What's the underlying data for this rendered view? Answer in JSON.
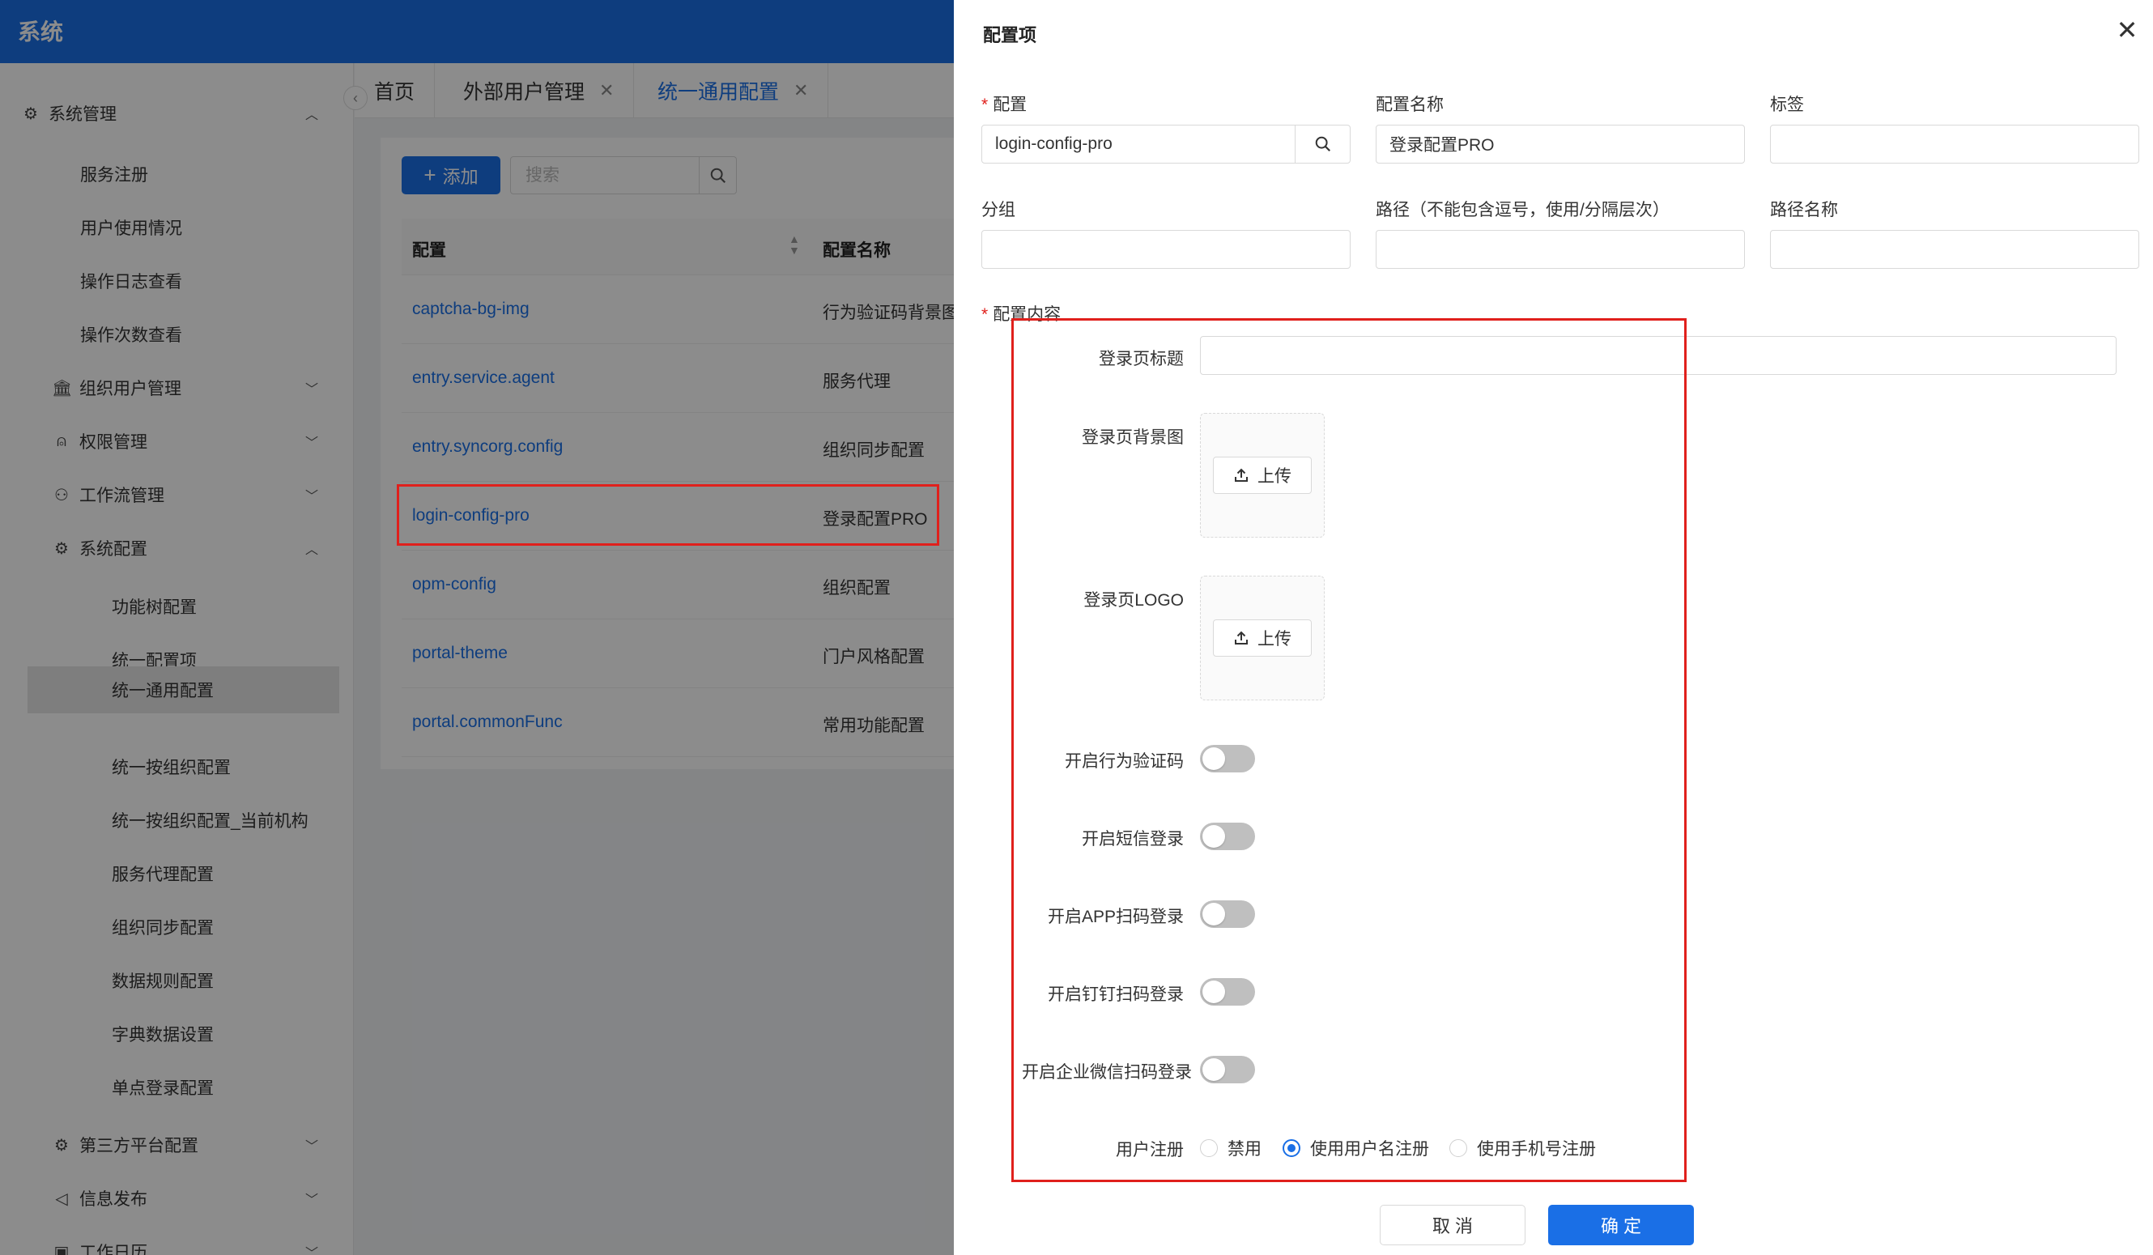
{
  "app": {
    "title": "系统"
  },
  "sidebar": {
    "items": [
      {
        "label": "系统管理",
        "icon": "gear-icon",
        "expanded": true
      },
      {
        "label": "服务注册"
      },
      {
        "label": "用户使用情况"
      },
      {
        "label": "操作日志查看"
      },
      {
        "label": "操作次数查看"
      },
      {
        "label": "组织用户管理",
        "icon": "bank-icon",
        "expanded": false
      },
      {
        "label": "权限管理",
        "icon": "user-icon",
        "expanded": false
      },
      {
        "label": "工作流管理",
        "icon": "workflow-icon",
        "expanded": false
      },
      {
        "label": "系统配置",
        "icon": "gear-icon",
        "expanded": true
      },
      {
        "label": "功能树配置"
      },
      {
        "label": "统一配置项"
      },
      {
        "label": "统一通用配置",
        "active": true
      },
      {
        "label": "统一按组织配置"
      },
      {
        "label": "统一按组织配置_当前机构"
      },
      {
        "label": "服务代理配置"
      },
      {
        "label": "组织同步配置"
      },
      {
        "label": "数据规则配置"
      },
      {
        "label": "字典数据设置"
      },
      {
        "label": "单点登录配置"
      },
      {
        "label": "第三方平台配置",
        "icon": "gear-icon",
        "expanded": false
      },
      {
        "label": "信息发布",
        "icon": "megaphone-icon",
        "expanded": false
      },
      {
        "label": "工作日历",
        "icon": "calendar-icon",
        "expanded": false
      }
    ]
  },
  "tabs": [
    {
      "label": "首页"
    },
    {
      "label": "外部用户管理"
    },
    {
      "label": "统一通用配置",
      "active": true
    }
  ],
  "list": {
    "add_label": "添加",
    "search_placeholder": "搜索",
    "columns": [
      "配置",
      "配置名称"
    ],
    "rows": [
      {
        "config": "captcha-bg-img",
        "name": "行为验证码背景图"
      },
      {
        "config": "entry.service.agent",
        "name": "服务代理"
      },
      {
        "config": "entry.syncorg.config",
        "name": "组织同步配置"
      },
      {
        "config": "login-config-pro",
        "name": "登录配置PRO",
        "highlighted": true
      },
      {
        "config": "opm-config",
        "name": "组织配置"
      },
      {
        "config": "portal-theme",
        "name": "门户风格配置"
      },
      {
        "config": "portal.commonFunc",
        "name": "常用功能配置"
      }
    ]
  },
  "drawer": {
    "title": "配置项",
    "fields": {
      "config": {
        "label": "配置",
        "value": "login-config-pro",
        "required": true
      },
      "config_name": {
        "label": "配置名称",
        "value": "登录配置PRO"
      },
      "tag": {
        "label": "标签",
        "value": ""
      },
      "group": {
        "label": "分组",
        "value": ""
      },
      "path": {
        "label": "路径（不能包含逗号，使用/分隔层次）",
        "value": ""
      },
      "path_name": {
        "label": "路径名称",
        "value": ""
      }
    },
    "content_label": "配置内容",
    "content": {
      "login_title_label": "登录页标题",
      "login_title_value": "",
      "bg_image_label": "登录页背景图",
      "logo_label": "登录页LOGO",
      "upload_label": "上传",
      "switches": [
        {
          "label": "开启行为验证码",
          "on": false
        },
        {
          "label": "开启短信登录",
          "on": false
        },
        {
          "label": "开启APP扫码登录",
          "on": false
        },
        {
          "label": "开启钉钉扫码登录",
          "on": false
        },
        {
          "label": "开启企业微信扫码登录",
          "on": false
        }
      ],
      "register_label": "用户注册",
      "register_options": [
        {
          "label": "禁用",
          "selected": false
        },
        {
          "label": "使用用户名注册",
          "selected": true
        },
        {
          "label": "使用手机号注册",
          "selected": false
        }
      ]
    },
    "cancel_label": "取 消",
    "ok_label": "确 定"
  },
  "colors": {
    "primary": "#1a6fe6",
    "highlight_border": "#e0201c",
    "mask": "rgba(0,0,0,0.45)"
  }
}
